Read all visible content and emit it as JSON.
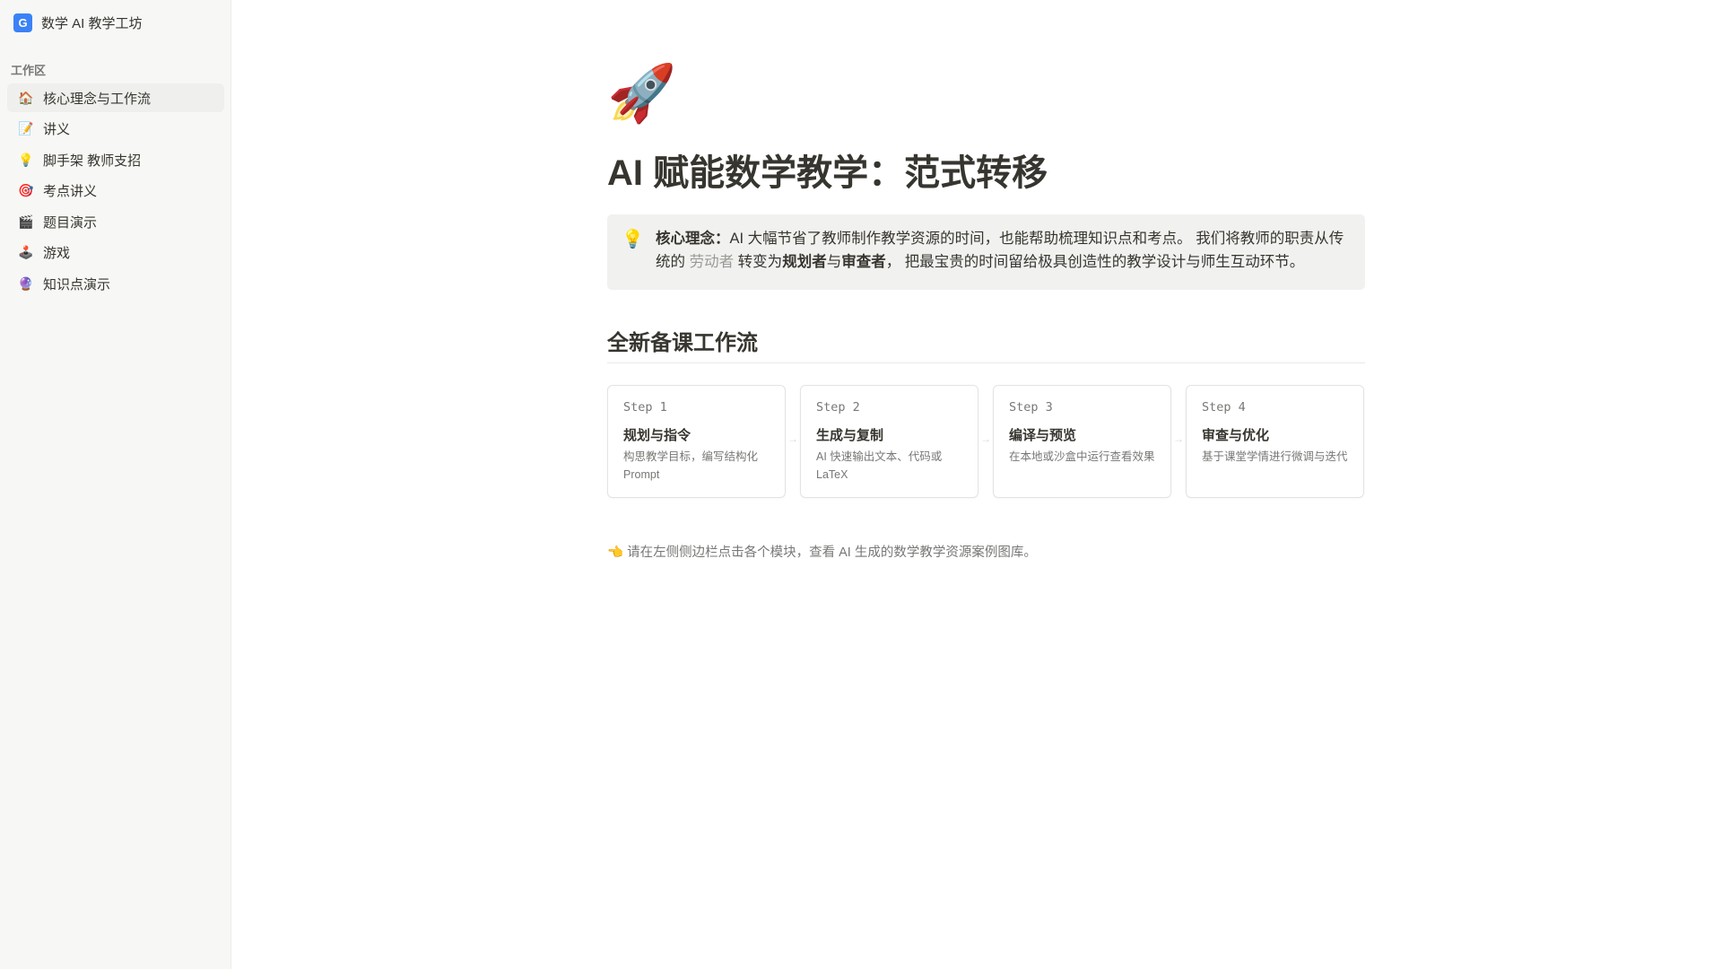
{
  "sidebar": {
    "brand_logo": "G",
    "brand_name": "数学 AI 教学工坊",
    "section_label": "工作区",
    "items": [
      {
        "icon": "🏠",
        "label": "核心理念与工作流"
      },
      {
        "icon": "📝",
        "label": "讲义"
      },
      {
        "icon": "💡",
        "label": "脚手架 教师支招"
      },
      {
        "icon": "🎯",
        "label": "考点讲义"
      },
      {
        "icon": "🎬",
        "label": "题目演示"
      },
      {
        "icon": "🕹️",
        "label": "游戏"
      },
      {
        "icon": "🔮",
        "label": "知识点演示"
      }
    ]
  },
  "main": {
    "hero_icon": "🚀",
    "title": "AI 赋能数学教学：范式转移",
    "callout": {
      "icon": "💡",
      "label": "核心理念：",
      "text1": "AI 大幅节省了教师制作教学资源的时间，也能帮助梳理知识点和考点。 我们将教师的职责从传统的 ",
      "muted": "劳动者",
      "text2": " 转变为",
      "bold1": "规划者",
      "text3": "与",
      "bold2": "审查者",
      "text4": "， 把最宝贵的时间留给极具创造性的教学设计与师生互动环节。"
    },
    "section_title": "全新备课工作流",
    "steps": [
      {
        "num": "Step 1",
        "title": "规划与指令",
        "desc": "构思教学目标，编写结构化 Prompt"
      },
      {
        "num": "Step 2",
        "title": "生成与复制",
        "desc": "AI 快速输出文本、代码或 LaTeX"
      },
      {
        "num": "Step 3",
        "title": "编译与预览",
        "desc": "在本地或沙盒中运行查看效果"
      },
      {
        "num": "Step 4",
        "title": "审查与优化",
        "desc": "基于课堂学情进行微调与迭代"
      }
    ],
    "arrow": "→",
    "footer_icon": "👈",
    "footer": "请在左侧侧边栏点击各个模块，查看 AI 生成的数学教学资源案例图库。"
  }
}
